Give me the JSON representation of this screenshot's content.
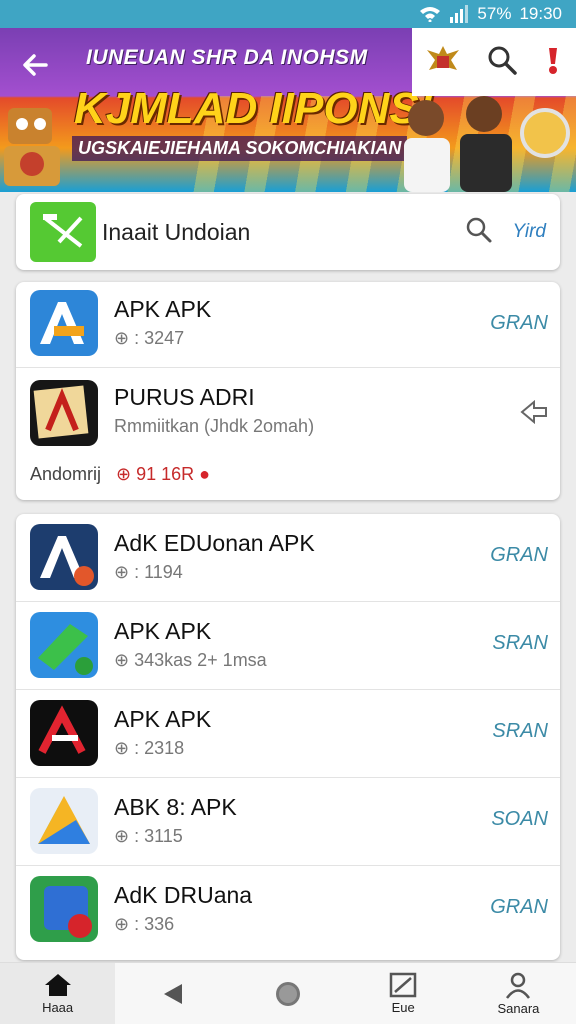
{
  "status_bar": {
    "battery": "57%",
    "time": "19:30"
  },
  "banner": {
    "title": "IUNEUAN SHR DA INOHSM",
    "headline": "KJMLAD IIPONS!",
    "subtitle": "UGSKAIEJIEHAMA SOKOMCHIAKIAN"
  },
  "search_card": {
    "label": "Inaait Undoian",
    "action": "Yird"
  },
  "list_1": [
    {
      "title": "APK APK",
      "meta": "3247",
      "action": "GRAN"
    },
    {
      "title": "PURUS ADRI",
      "meta": "Rmmiitkan (Jhdk 2omah)",
      "footer_left": "Andomrij",
      "footer_right": "91 16R"
    }
  ],
  "list_2": [
    {
      "title": "AdK EDUonan APK",
      "meta": "1194",
      "action": "GRAN"
    },
    {
      "title": "APK APK",
      "meta": "343kas 2+ 1msa",
      "action": "SRAN"
    },
    {
      "title": "APK APK",
      "meta": "2318",
      "action": "SRAN"
    },
    {
      "title": "ABK 8: APK",
      "meta": "3115",
      "action": "SOAN"
    },
    {
      "title": "AdK DRUana",
      "meta": "336",
      "action": "GRAN"
    }
  ],
  "nav": [
    {
      "label": "Haaa",
      "icon": "home-icon"
    },
    {
      "label": "",
      "icon": "back-triangle-icon"
    },
    {
      "label": "",
      "icon": "home-circle-icon"
    },
    {
      "label": "Eue",
      "icon": "image-icon"
    },
    {
      "label": "Sanara",
      "icon": "person-icon"
    }
  ],
  "colors": {
    "status_bar": "#3fa5c4",
    "accent_text": "#3b8aa6",
    "green_tile": "#55c933"
  }
}
